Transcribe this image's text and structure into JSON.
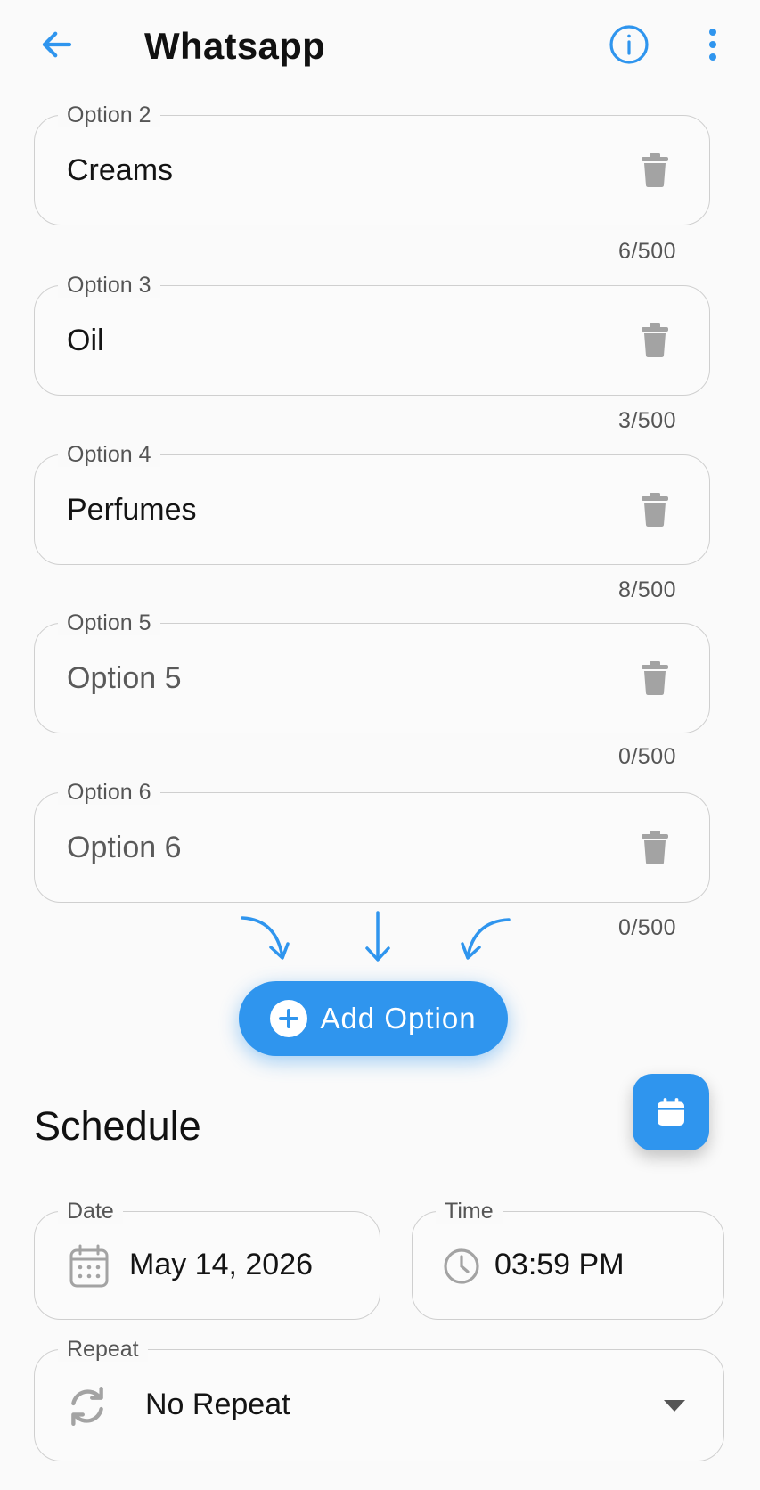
{
  "header": {
    "title": "Whatsapp",
    "back_icon": "arrow-left-icon",
    "info_icon": "info-icon",
    "more_icon": "more-vertical-icon",
    "accent": "#2f95ee"
  },
  "options": [
    {
      "label": "Option 2",
      "value": "Creams",
      "placeholder": "Option 2",
      "counter": "6/500"
    },
    {
      "label": "Option 3",
      "value": "Oil",
      "placeholder": "Option 3",
      "counter": "3/500"
    },
    {
      "label": "Option 4",
      "value": "Perfumes",
      "placeholder": "Option 4",
      "counter": "8/500"
    },
    {
      "label": "Option 5",
      "value": "",
      "placeholder": "Option 5",
      "counter": "0/500"
    },
    {
      "label": "Option 6",
      "value": "",
      "placeholder": "Option 6",
      "counter": "0/500"
    }
  ],
  "add_option": {
    "label": "Add Option",
    "icon": "plus-circle-icon"
  },
  "calendar_fab": {
    "icon": "calendar-icon"
  },
  "schedule": {
    "title": "Schedule",
    "date": {
      "label": "Date",
      "value": "May 14, 2026",
      "icon": "calendar-icon"
    },
    "time": {
      "label": "Time",
      "value": "03:59 PM",
      "icon": "clock-icon"
    },
    "repeat": {
      "label": "Repeat",
      "value": "No Repeat",
      "icon": "repeat-icon",
      "dropdown_icon": "caret-down-icon"
    }
  }
}
